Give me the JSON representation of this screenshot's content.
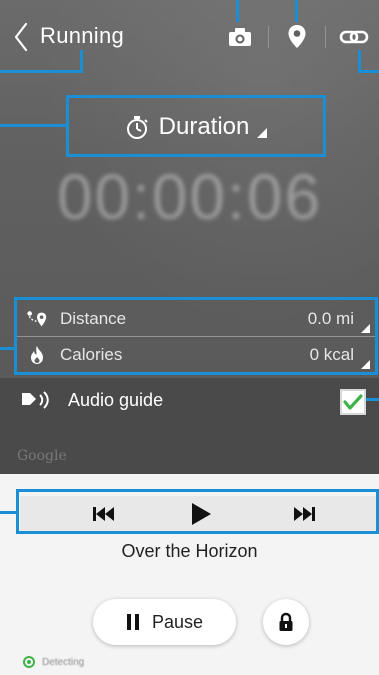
{
  "header": {
    "title": "Running",
    "back_icon": "chevron-left-icon",
    "actions": [
      {
        "name": "camera",
        "icon": "camera-icon"
      },
      {
        "name": "location",
        "icon": "map-pin-icon"
      },
      {
        "name": "link",
        "icon": "link-icon"
      }
    ]
  },
  "workout": {
    "mode_label": "Duration",
    "mode_icon": "stopwatch-icon",
    "timer": "00:00:06"
  },
  "stats": [
    {
      "label": "Distance",
      "value": "0.0 mi",
      "icon": "route-icon"
    },
    {
      "label": "Calories",
      "value": "0 kcal",
      "icon": "flame-icon"
    }
  ],
  "audio_guide": {
    "label": "Audio guide",
    "checked": true,
    "icon": "speaker-icon"
  },
  "map_attribution": "Google",
  "music": {
    "song_title": "Over the Horizon",
    "controls": [
      "previous-icon",
      "play-icon",
      "next-icon"
    ]
  },
  "actions": {
    "pause_label": "Pause",
    "lock_icon": "lock-icon"
  },
  "status": {
    "detecting_label": "Detecting"
  },
  "colors": {
    "callout_blue": "#1a8fd6",
    "check_green": "#3fb34a",
    "top_area": "#616161"
  }
}
